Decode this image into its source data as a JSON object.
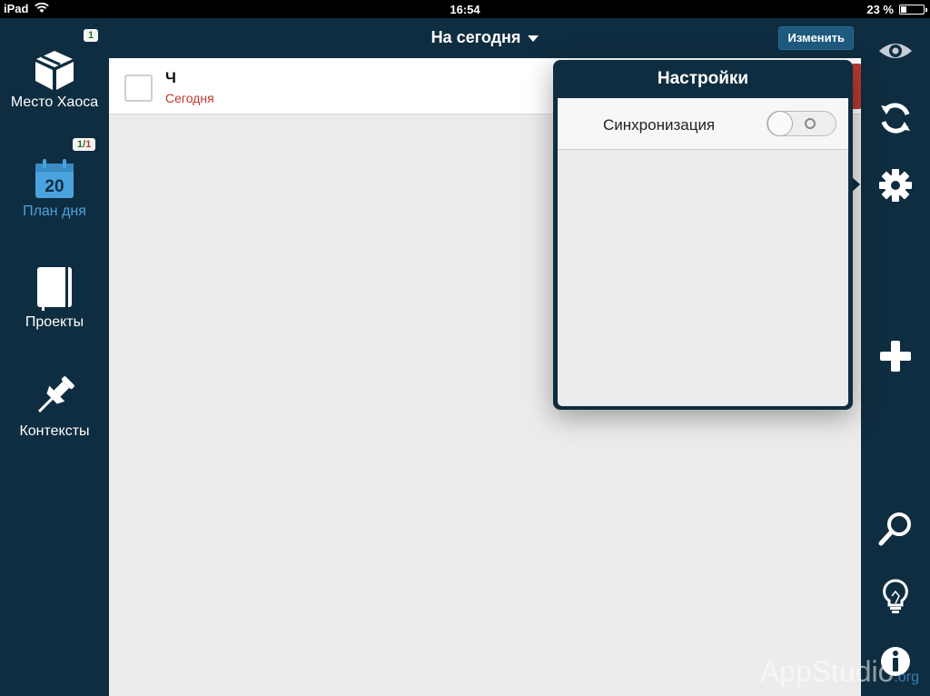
{
  "status_bar": {
    "carrier": "iPad",
    "time": "16:54",
    "battery": "23 %",
    "battery_level": 0.23
  },
  "sidebar": {
    "items": [
      {
        "label": "Место Хаоса",
        "icon": "box-icon",
        "badge": "1",
        "active": false
      },
      {
        "label": "План дня",
        "icon": "calendar-icon",
        "calendar_day": "20",
        "badge_green": "1",
        "badge_red": "1",
        "active": true
      },
      {
        "label": "Проекты",
        "icon": "notebook-icon",
        "active": false
      },
      {
        "label": "Контексты",
        "icon": "pin-icon",
        "active": false
      }
    ]
  },
  "topbar": {
    "title": "На сегодня",
    "edit_label": "Изменить"
  },
  "tasks": [
    {
      "title": "Ч",
      "date": "Сегодня"
    }
  ],
  "popover": {
    "title": "Настройки",
    "sync_label": "Синхронизация",
    "sync_on": false
  },
  "right_sidebar": {
    "icons": [
      "eye-icon",
      "sync-icon",
      "gear-icon",
      "plus-icon",
      "search-icon",
      "lightbulb-icon",
      "info-icon"
    ]
  },
  "watermark": {
    "text": "AppStudio",
    "suffix": ".org"
  },
  "colors": {
    "navy": "#0f2d40",
    "accent_blue": "#4aa3df",
    "date_red": "#c0392b",
    "edit_button": "#1e5a7f"
  }
}
